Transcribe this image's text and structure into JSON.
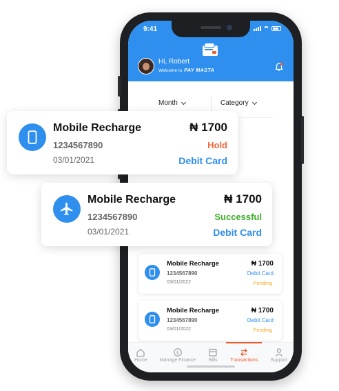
{
  "status_bar": {
    "time": "9:41"
  },
  "header": {
    "greeting": "Hi, Robert",
    "welcome": "Welcome to",
    "brand": "PAY MASTA"
  },
  "filters": {
    "month": "Month",
    "category": "Category"
  },
  "feature_cards": [
    {
      "icon": "phone-icon",
      "title": "Mobile Recharge",
      "number": "1234567890",
      "date": "03/01/2021",
      "amount": "₦ 1700",
      "status": "Hold",
      "status_color": "#ee6a3b",
      "method": "Debit Card"
    },
    {
      "icon": "airplane-icon",
      "title": "Mobile Recharge",
      "number": "1234567890",
      "date": "03/01/2021",
      "amount": "₦ 1700",
      "status": "Successful",
      "status_color": "#3fae2a",
      "method": "Debit Card"
    }
  ],
  "transactions": [
    {
      "icon": "phone-icon",
      "title": "Mobile Recharge",
      "number": "1234567890",
      "date": "03/01/2022",
      "amount": "₦ 1700",
      "method": "Debit Card",
      "status": "Pending"
    },
    {
      "icon": "phone-icon",
      "title": "Mobile Recharge",
      "number": "1234567890",
      "date": "03/01/2022",
      "amount": "₦ 1700",
      "method": "Debit Card",
      "status": "Pending"
    }
  ],
  "nav": {
    "items": [
      {
        "label": "Home",
        "icon": "home-icon"
      },
      {
        "label": "Manage Finance",
        "icon": "finance-icon"
      },
      {
        "label": "Bills",
        "icon": "bills-icon"
      },
      {
        "label": "Transactions",
        "icon": "transactions-icon",
        "active": true
      },
      {
        "label": "Support",
        "icon": "support-icon"
      }
    ]
  },
  "colors": {
    "primary": "#2f8fee",
    "accent": "#ee5a2b",
    "pending": "#f5a623"
  }
}
